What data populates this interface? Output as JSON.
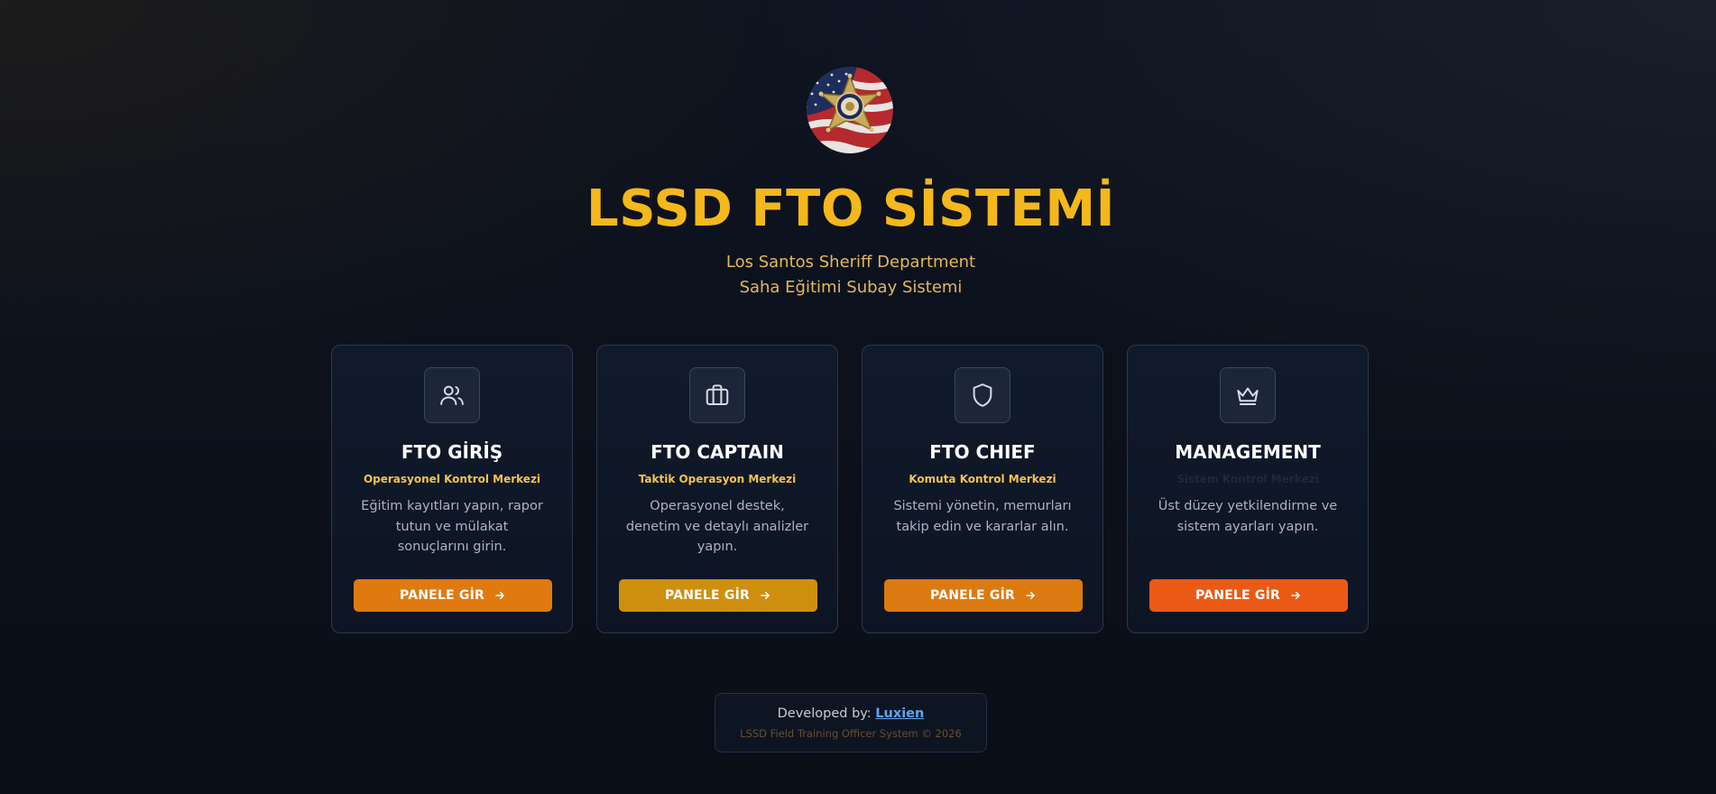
{
  "header": {
    "title": "LSSD FTO SİSTEMİ",
    "subtitle_line1": "Los Santos Sheriff Department",
    "subtitle_line2": "Saha Eğitimi Subay Sistemi"
  },
  "cards": [
    {
      "icon": "users-icon",
      "title": "FTO GİRİŞ",
      "subtitle": "Operasyonel Kontrol Merkezi",
      "description": "Eğitim kayıtları yapın, rapor tutun ve mülakat sonuçlarını girin.",
      "button_label": "PANELE GİR",
      "button_color": "#e07a10"
    },
    {
      "icon": "briefcase-icon",
      "title": "FTO CAPTAIN",
      "subtitle": "Taktik Operasyon Merkezi",
      "description": "Operasyonel destek, denetim ve detaylı analizler yapın.",
      "button_label": "PANELE GİR",
      "button_color": "#cf8f0e"
    },
    {
      "icon": "shield-icon",
      "title": "FTO CHIEF",
      "subtitle": "Komuta Kontrol Merkezi",
      "description": "Sistemi yönetin, memurları takip edin ve kararlar alın.",
      "button_label": "PANELE GİR",
      "button_color": "#dc7a12"
    },
    {
      "icon": "crown-icon",
      "title": "MANAGEMENT",
      "subtitle": "Sistem Kontrol Merkezi",
      "description": "Üst düzey yetkilendirme ve sistem ayarları yapın.",
      "button_label": "PANELE GİR",
      "button_color": "#ea5a16"
    }
  ],
  "footer": {
    "developed_by_label": "Developed by:",
    "developer_name": "Luxien",
    "copyright": "LSSD Field Training Officer System © 2026"
  },
  "colors": {
    "accent": "#f4b71c",
    "subtitle": "#e5b65d",
    "link": "#5fa4f2"
  }
}
